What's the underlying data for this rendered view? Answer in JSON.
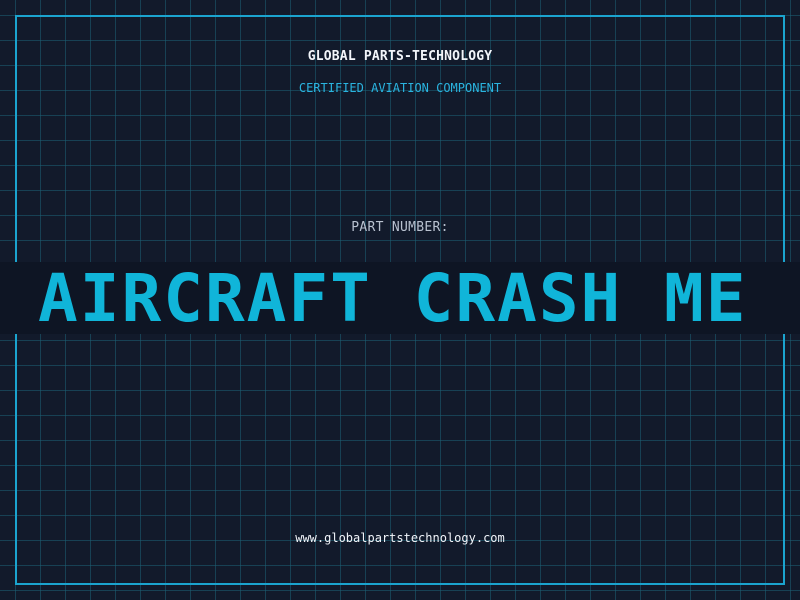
{
  "header": {
    "company": "GLOBAL PARTS-TECHNOLOGY",
    "subtitle": "CERTIFIED AVIATION COMPONENT"
  },
  "part": {
    "label": "PART NUMBER:",
    "value": "AIRCRAFT CRASH ME"
  },
  "footer": {
    "website": "www.globalpartstechnology.com"
  },
  "colors": {
    "background": "#121a2b",
    "accent": "#1ba4cf",
    "banner_text": "#10b5d9"
  }
}
